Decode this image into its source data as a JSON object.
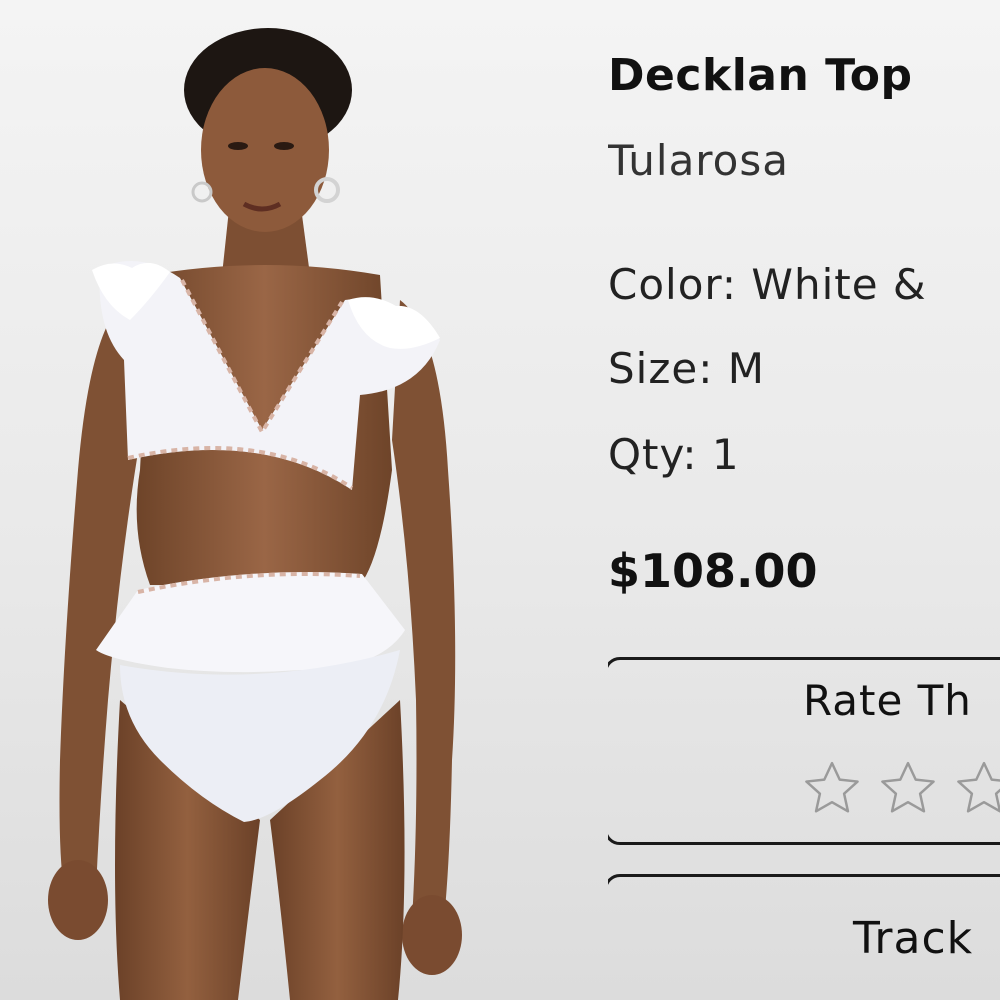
{
  "product": {
    "name": "Decklan Top",
    "brand": "Tularosa",
    "color_label": "Color: White &",
    "size_label": "Size: M",
    "qty_label": "Qty: 1",
    "price": "$108.00"
  },
  "rating": {
    "label": "Rate Th",
    "stars_visible": 3,
    "value": 0,
    "star_icon": "star-outline-icon"
  },
  "track": {
    "label": "Track"
  },
  "colors": {
    "text": "#111111",
    "border": "#1a1a1a",
    "star_outline": "#9a9a9a",
    "garment": "#f3f3f8",
    "skin": "#8a5a3c"
  }
}
